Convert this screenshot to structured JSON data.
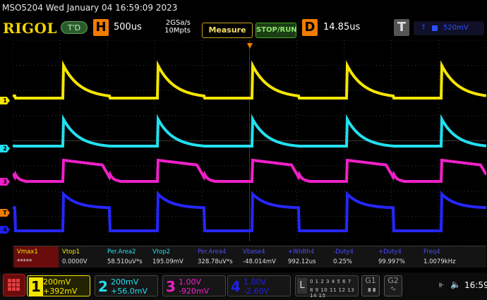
{
  "titlebar": {
    "text": "MSO5204  Wed January 04 16:59:09 2023"
  },
  "topbar": {
    "logo": "RIGOL",
    "trigger_status": "T'D",
    "horizontal": {
      "badge": "H",
      "timebase": "500us",
      "sample_rate": "2GSa/s",
      "memory": "10Mpts"
    },
    "measure_label": "Measure",
    "stoprun_label": "STOP/RUN",
    "delay": {
      "badge": "D",
      "value": "14.85us"
    },
    "trigger": {
      "badge": "T",
      "level": "520mV"
    }
  },
  "channel_markers": [
    {
      "label": "1",
      "color": "#f5e600"
    },
    {
      "label": "2",
      "color": "#22e0ee"
    },
    {
      "label": "3",
      "color": "#f020c8"
    },
    {
      "label": "T",
      "color": "#f07c00"
    },
    {
      "label": "4",
      "color": "#2020f0"
    }
  ],
  "measurements": [
    {
      "label": "Vmax1",
      "value": "*****",
      "color": "#f5e600",
      "highlight": true
    },
    {
      "label": "Vtop1",
      "value": "0.0000V",
      "color": "#f5e600"
    },
    {
      "label": "Per.Area2",
      "value": "58.510uV*s",
      "color": "#22e0ee"
    },
    {
      "label": "Vtop2",
      "value": "195.09mV",
      "color": "#22e0ee"
    },
    {
      "label": "Per.Area4",
      "value": "328.78uV*s",
      "color": "#4d4dff"
    },
    {
      "label": "Vbase4",
      "value": "-48.014mV",
      "color": "#4d4dff"
    },
    {
      "label": "+Width4",
      "value": "992.12us",
      "color": "#4d4dff"
    },
    {
      "label": "-Duty4",
      "value": "0.25%",
      "color": "#4d4dff"
    },
    {
      "label": "+Duty4",
      "value": "99.997%",
      "color": "#4d4dff"
    },
    {
      "label": "Freq4",
      "value": "1.0079kHz",
      "color": "#4d4dff"
    }
  ],
  "channels": [
    {
      "num": "1",
      "scale": "200mV",
      "offset": "+392mV",
      "color": "#f5e600",
      "active": true
    },
    {
      "num": "2",
      "scale": "200mV",
      "offset": "+56.0mV",
      "color": "#22e0ee"
    },
    {
      "num": "3",
      "scale": "1.00V",
      "offset": "-920mV",
      "color": "#f020c8"
    },
    {
      "num": "4",
      "scale": "1.00V",
      "offset": "-2.60V",
      "color": "#2020f0"
    }
  ],
  "logic": {
    "badge": "L",
    "row1": "0 1 2 3  4 5 6 7",
    "row2": "8 9 10 11 12 13 14 15"
  },
  "generators": [
    {
      "label": "G1"
    },
    {
      "label": "G2"
    }
  ],
  "clock": "16:59"
}
